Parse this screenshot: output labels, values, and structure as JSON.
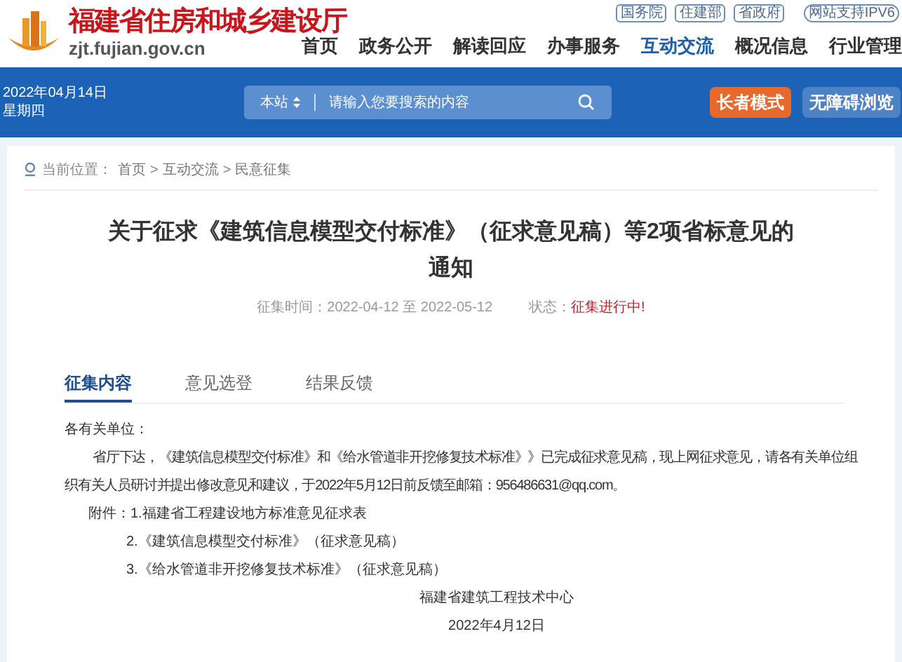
{
  "header": {
    "site_title": "福建省住房和城乡建设厅",
    "domain": "zjt.fujian.gov.cn",
    "top_links": [
      "国务院",
      "住建部",
      "省政府",
      "网站支持IPV6"
    ],
    "nav": [
      {
        "label": "首页",
        "selected": false
      },
      {
        "label": "政务公开",
        "selected": false
      },
      {
        "label": "解读回应",
        "selected": false
      },
      {
        "label": "办事服务",
        "selected": false
      },
      {
        "label": "互动交流",
        "selected": true
      },
      {
        "label": "概况信息",
        "selected": false
      },
      {
        "label": "行业管理",
        "selected": false
      }
    ]
  },
  "banner": {
    "date": "2022年04月14日",
    "weekday": "星期四",
    "scope": "本站",
    "search_placeholder": "请输入您要搜索的内容",
    "buttons": [
      {
        "label": "长者模式",
        "kind": "elder"
      },
      {
        "label": "无障碍浏览",
        "kind": "access"
      }
    ]
  },
  "breadcrumb": {
    "label": "当前位置：",
    "items": [
      "首页",
      "互动交流",
      "民意征集"
    ],
    "separator": ">"
  },
  "article": {
    "title": "关于征求《建筑信息模型交付标准》（征求意见稿）等2项省标意见的通知",
    "period_label": "征集时间：",
    "period": "2022-04-12 至 2022-05-12",
    "status_label": "状态：",
    "status": "征集进行中!",
    "tabs": [
      {
        "label": "征集内容",
        "selected": true
      },
      {
        "label": "意见选登",
        "selected": false
      },
      {
        "label": "结果反馈",
        "selected": false
      }
    ],
    "greeting": "各有关单位：",
    "body": "省厅下达，《建筑信息模型交付标准》和《给水管道非开挖修复技术标准》》已完成征求意见稿，现上网征求意见，请各有关单位组织有关人员研讨并提出修改意见和建议，于2022年5月12日前反馈至邮箱：956486631@qq.com。",
    "attachments_label": "附件：",
    "attachments": [
      "1.福建省工程建设地方标准意见征求表",
      "2.《建筑信息模型交付标准》（征求意见稿）",
      "3.《给水管道非开挖修复技术标准》（征求意见稿）"
    ],
    "signature": "福建省建筑工程技术中心",
    "date": "2022年4月12日"
  }
}
